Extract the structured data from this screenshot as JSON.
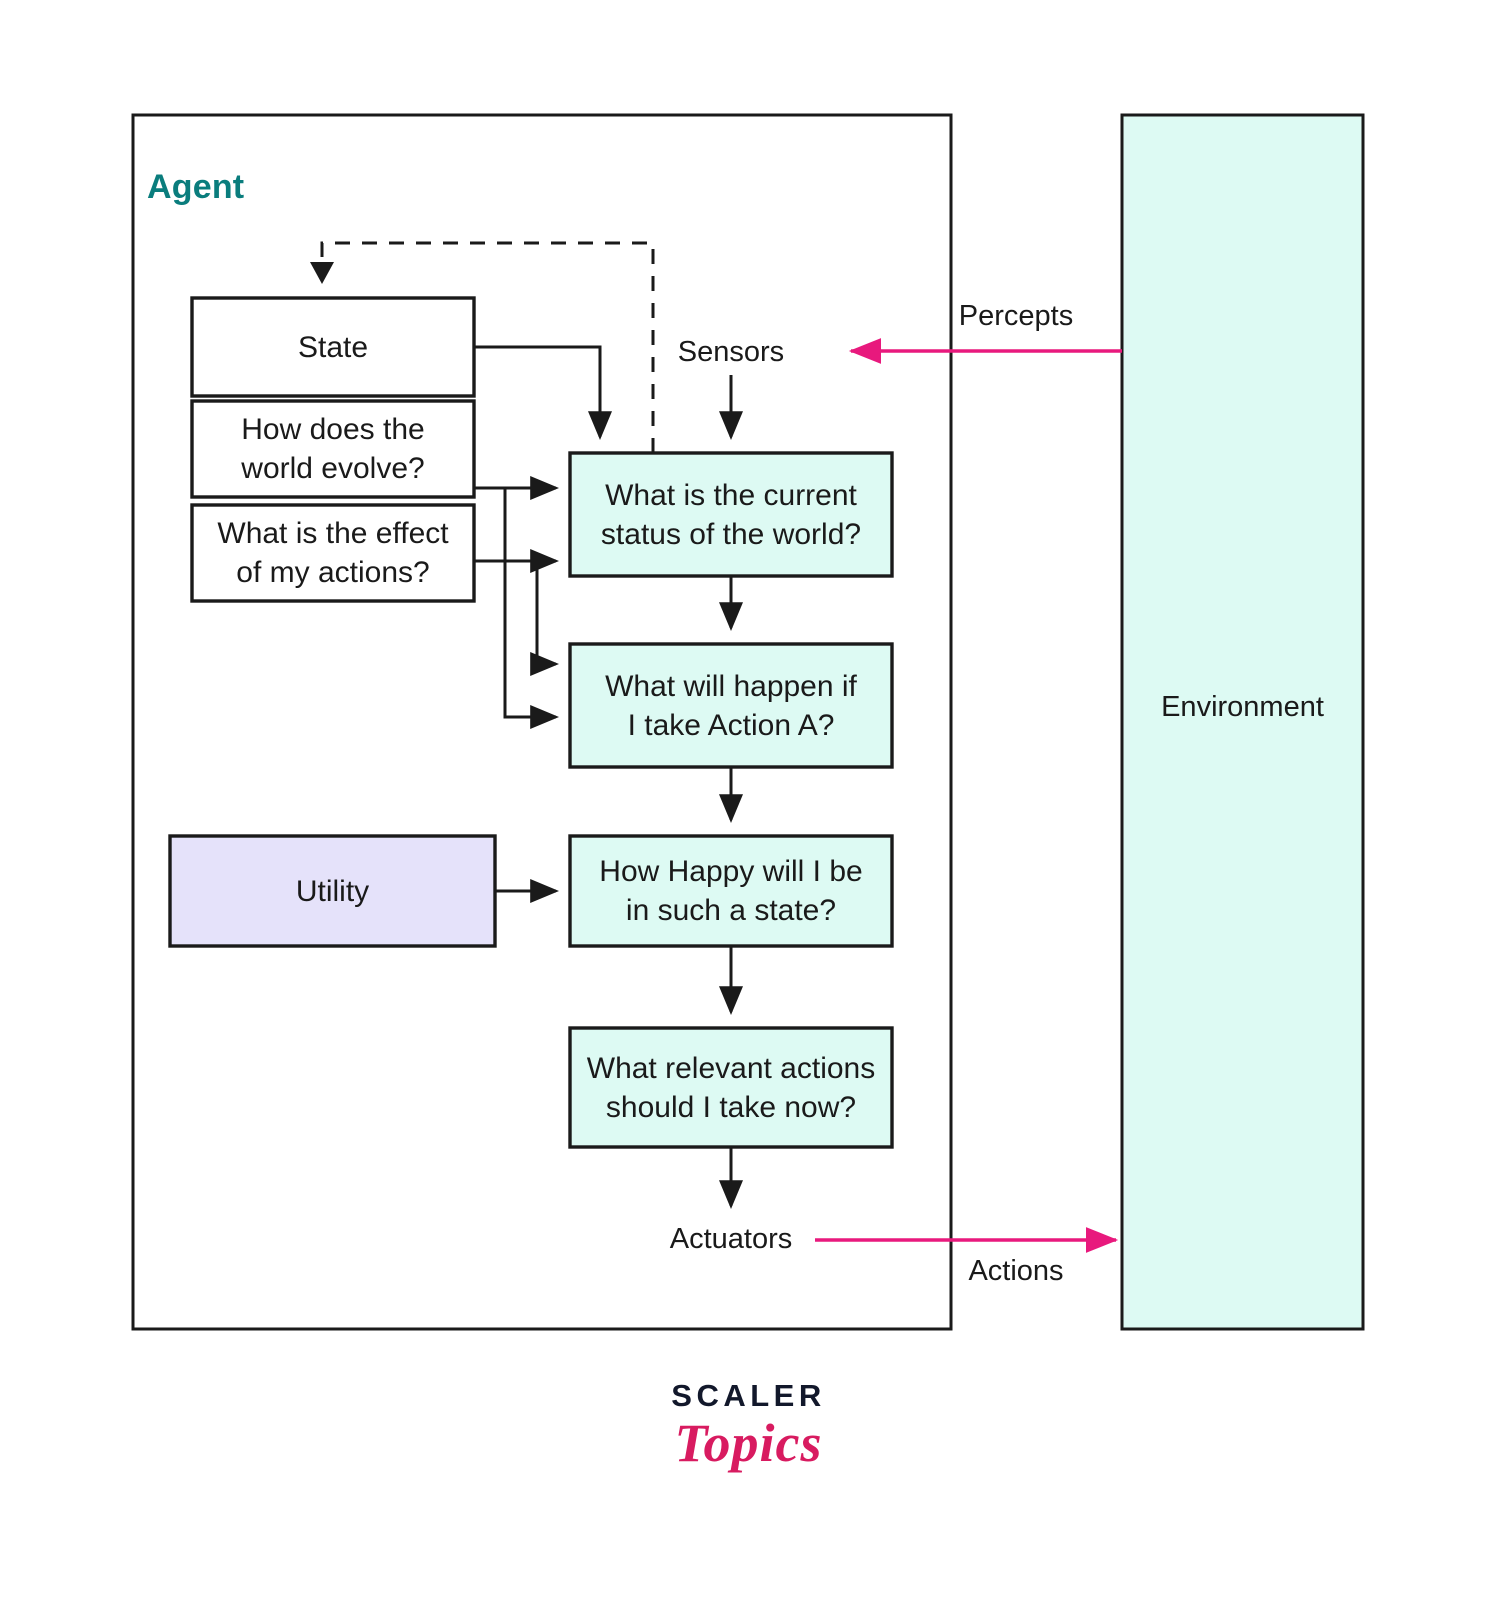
{
  "diagram": {
    "title_agent": "Agent",
    "environment_label": "Environment",
    "sensors_label": "Sensors",
    "actuators_label": "Actuators",
    "percepts_label": "Percepts",
    "actions_label": "Actions",
    "colors": {
      "agent_title": "#0a7d7d",
      "cyan_fill": "#ddfaf3",
      "lavender_fill": "#e5e2fa",
      "white_fill": "#ffffff",
      "stroke": "#1a1a1a",
      "arrow_pink": "#e8197d",
      "logo_dark": "#12182b",
      "logo_pink": "#d81b60"
    },
    "boxes": {
      "state": "State",
      "world_evolve_line1": "How does the",
      "world_evolve_line2": "world evolve?",
      "effect_actions_line1": "What is the effect",
      "effect_actions_line2": "of my actions?",
      "utility": "Utility",
      "current_status_line1": "What is the current",
      "current_status_line2": "status of the world?",
      "what_happen_line1": "What will happen if",
      "what_happen_line2": "I take Action A?",
      "how_happy_line1": "How Happy will I be",
      "how_happy_line2": "in such a state?",
      "relevant_actions_line1": "What relevant actions",
      "relevant_actions_line2": "should I take now?"
    }
  },
  "logo": {
    "primary": "SCALER",
    "secondary": "Topics"
  }
}
